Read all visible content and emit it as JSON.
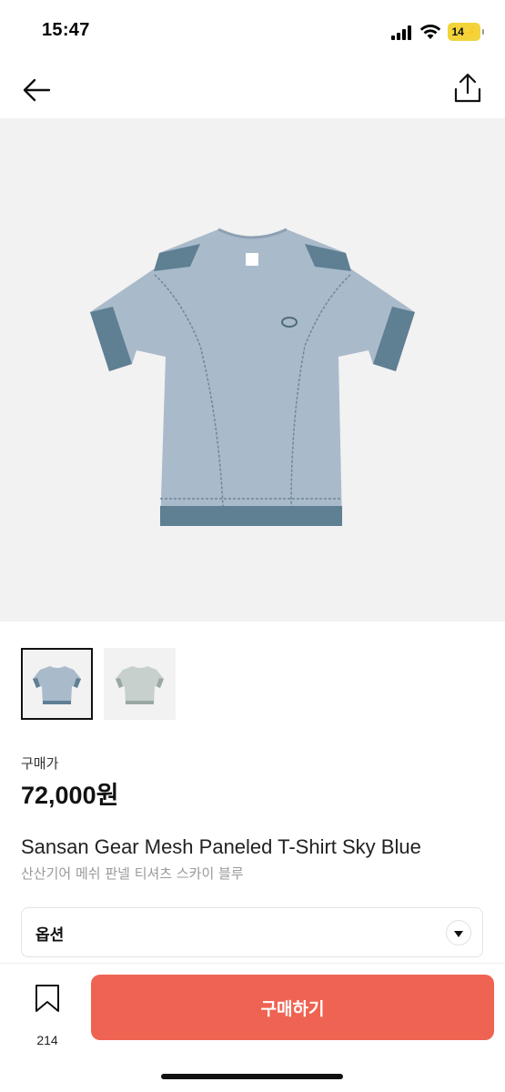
{
  "status_bar": {
    "time": "15:47",
    "battery_level": "14",
    "battery_color": "#f2d43a",
    "icons": [
      "cellular-signal-icon",
      "wifi-icon",
      "battery-charging-icon"
    ]
  },
  "nav": {
    "back_icon": "arrow-left-icon",
    "share_icon": "share-upload-icon"
  },
  "product": {
    "image_alt_icon": "t-shirt-image",
    "thumbnails": [
      {
        "selected": true,
        "color": "#a9bacb"
      },
      {
        "selected": false,
        "color": "#c7d0cc"
      }
    ],
    "price_label": "구매가",
    "price": "72,000원",
    "title_en": "Sansan Gear Mesh Paneled T-Shirt Sky Blue",
    "title_ko": "산산기어 메쉬 판넬 티셔츠 스카이 블루"
  },
  "option": {
    "label": "옵션",
    "chevron_icon": "chevron-down-icon"
  },
  "bottom_bar": {
    "bookmark_icon": "bookmark-icon",
    "bookmark_count": "214",
    "buy_label": "구매하기",
    "buy_color": "#ef6352"
  }
}
